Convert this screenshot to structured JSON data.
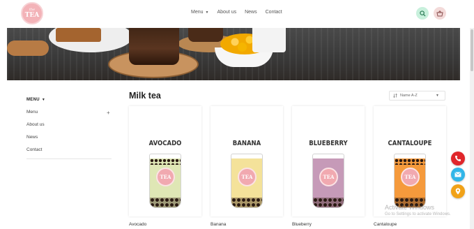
{
  "logo": {
    "line1": "the",
    "line2": "TEA"
  },
  "nav": {
    "menu": "Menu",
    "about": "About us",
    "news": "News",
    "contact": "Contact"
  },
  "header_icons": {
    "search": "search-icon",
    "cart": "basket-icon"
  },
  "sidebar": {
    "title": "MENU",
    "items": [
      {
        "label": "Menu",
        "expand": "+"
      },
      {
        "label": "About us"
      },
      {
        "label": "News"
      },
      {
        "label": "Contact"
      }
    ]
  },
  "main": {
    "title": "Milk tea",
    "sort": {
      "label": "Name A-Z"
    }
  },
  "products": [
    {
      "card_title": "AVOCADO",
      "name": "Avocado",
      "badge": "TEA",
      "color": "#dfe7b5"
    },
    {
      "card_title": "BANANA",
      "name": "Banana",
      "badge": "TEA",
      "color": "#f4e29a"
    },
    {
      "card_title": "BLUEBERRY",
      "name": "Blueberry",
      "badge": "TEA",
      "color": "#c69ab8"
    },
    {
      "card_title": "CANTALOUPE",
      "name": "Cantaloupe",
      "badge": "TEA",
      "color": "#f59a3c"
    }
  ],
  "floating": {
    "phone": "phone-icon",
    "mail": "mail-icon",
    "map": "map-pin-icon"
  },
  "watermark": {
    "line1": "Activate Windows",
    "line2": "Go to Settings to activate Windows."
  }
}
